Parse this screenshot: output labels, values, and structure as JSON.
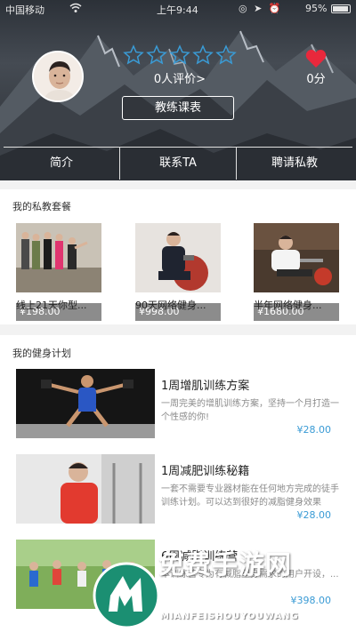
{
  "status_bar": {
    "carrier": "中国移动",
    "time": "上午9:44",
    "battery": "95%"
  },
  "coach": {
    "rating_text": "0人评价>",
    "score": "0分",
    "stars_total": 5,
    "stars_filled": 0
  },
  "schedule_button": "教练课表",
  "tabs": [
    {
      "label": "简介"
    },
    {
      "label": "联系TA"
    },
    {
      "label": "聘请私教"
    }
  ],
  "packages": {
    "title": "我的私教套餐",
    "items": [
      {
        "price": "¥198.00",
        "name": "线上21天你型..."
      },
      {
        "price": "¥998.00",
        "name": "90天网络健身..."
      },
      {
        "price": "¥1680.00",
        "name": "半年网络健身..."
      }
    ]
  },
  "plans": {
    "title": "我的健身计划",
    "items": [
      {
        "title": "1周增肌训练方案",
        "desc": "一周完美的增肌训练方案，坚持一个月打造一个性感的你!",
        "price": "¥28.00"
      },
      {
        "title": "1周减肥训练秘籍",
        "desc": "一套不需要专业器材能在任何地方完成的徒手训练计划。可以达到很好的减脂健身效果",
        "price": "¥28.00"
      },
      {
        "title": "6周减脂训练营",
        "desc": "本训练营专为有减脂塑身需求的用户开设，...",
        "price": "¥398.00"
      }
    ]
  },
  "watermark": {
    "text": "免费手游网",
    "sub": "MIANFEISHOUYOUWANG"
  },
  "colors": {
    "accent": "#3a9bd5",
    "heart": "#e8283c",
    "star_outline": "#3a9bd5"
  }
}
